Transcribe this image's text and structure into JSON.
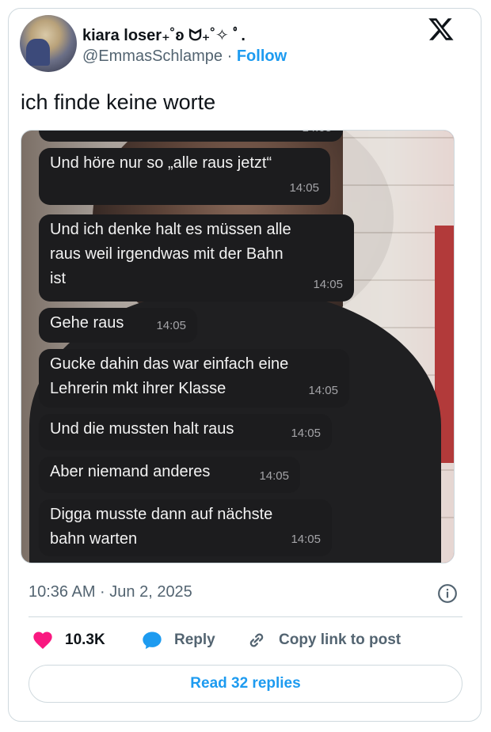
{
  "author": {
    "display_name": "kiara loser₊˚ʚ ᗢ₊˚✧ ﾟ.",
    "handle": "@EmmasSchlampe",
    "separator": "·",
    "follow_label": "Follow"
  },
  "tweet": {
    "text": "ich finde keine worte",
    "timestamp": "10:36 AM · Jun 2, 2025"
  },
  "screenshot_chat": {
    "cut_time_top": "14:05",
    "messages": [
      {
        "text": "Und höre nur so „alle raus jetzt“",
        "time": "14:05"
      },
      {
        "text": "Und ich denke halt es müssen alle\nraus weil irgendwas mit der Bahn\nist",
        "time": "14:05"
      },
      {
        "text": "Gehe raus",
        "time": "14:05"
      },
      {
        "text": "Gucke dahin das war einfach eine\nLehrerin mkt ihrer Klasse",
        "time": "14:05"
      },
      {
        "text": "Und die mussten halt raus",
        "time": "14:05"
      },
      {
        "text": "Aber niemand anderes",
        "time": "14:05"
      },
      {
        "text": "Digga musste dann auf nächste\nbahn warten",
        "time": "14:05"
      }
    ]
  },
  "actions": {
    "likes": "10.3K",
    "reply": "Reply",
    "copy_link": "Copy link to post"
  },
  "read_replies": "Read 32 replies",
  "colors": {
    "accent": "#1d9bf0",
    "like": "#f91880",
    "text": "#0f1419",
    "muted": "#536471"
  },
  "icons": {
    "brand": "x-logo-icon",
    "info": "info-icon",
    "like": "heart-icon",
    "reply": "speech-bubble-icon",
    "copy": "link-icon"
  }
}
